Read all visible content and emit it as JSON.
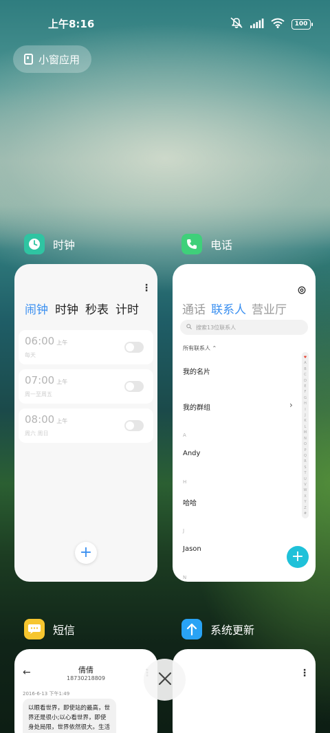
{
  "status_bar": {
    "time": "上午8:16",
    "battery": "100"
  },
  "small_window_button": {
    "label": "小窗应用"
  },
  "apps": {
    "clock": {
      "name": "时钟",
      "tabs": [
        "闹钟",
        "时钟",
        "秒表",
        "计时"
      ],
      "active_tab": "闹钟",
      "alarms": [
        {
          "time": "06:00",
          "ampm": "上午",
          "repeat": "每天",
          "enabled": false
        },
        {
          "time": "07:00",
          "ampm": "上午",
          "repeat": "周一至周五",
          "enabled": false
        },
        {
          "time": "08:00",
          "ampm": "上午",
          "repeat": "周六 周日",
          "enabled": false
        }
      ]
    },
    "phone": {
      "name": "电话",
      "tabs": [
        "通话",
        "联系人",
        "营业厅"
      ],
      "active_tab": "联系人",
      "search_placeholder": "搜索13位联系人",
      "filter": "所有联系人",
      "my_card": "我的名片",
      "my_groups": "我的群组",
      "sections": [
        {
          "letter": "A",
          "contact": "Andy"
        },
        {
          "letter": "H",
          "contact": "哈哈"
        },
        {
          "letter": "J",
          "contact": "Jason"
        },
        {
          "letter": "N",
          "contact": ""
        }
      ],
      "alphabet": [
        "A",
        "B",
        "C",
        "D",
        "E",
        "F",
        "G",
        "H",
        "I",
        "J",
        "K",
        "L",
        "M",
        "N",
        "O",
        "P",
        "Q",
        "R",
        "S",
        "T",
        "U",
        "V",
        "W",
        "X",
        "Y",
        "Z",
        "#"
      ]
    },
    "sms": {
      "name": "短信",
      "contact_name": "倩倩",
      "contact_number": "18730218809",
      "date": "2016-6-13 下午1:49",
      "message": "以眼看世界，即使站的最高，世界还是很小;以心看世界，即使身处局限，世界依然很大。生活远"
    },
    "update": {
      "name": "系统更新"
    }
  },
  "colors": {
    "accent_blue": "#3a8ff0",
    "clock_icon": "#2fc4a2",
    "phone_icon": "#3fd07a",
    "sms_icon": "#f6c62f",
    "update_icon": "#29a3f5",
    "phone_fab": "#1fc1d9"
  }
}
